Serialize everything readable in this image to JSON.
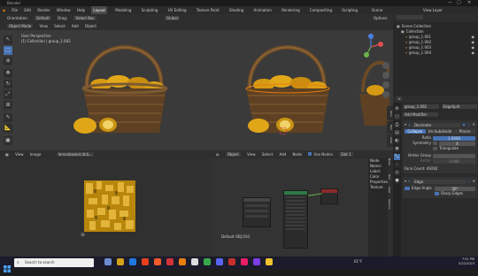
{
  "window": {
    "title": "Blender",
    "controls": [
      "—",
      "▢",
      "✕"
    ]
  },
  "menubar": {
    "logo": "◆",
    "menus": [
      "File",
      "Edit",
      "Render",
      "Window",
      "Help"
    ],
    "workspaces": [
      "Layout",
      "Modeling",
      "Sculpting",
      "UV Editing",
      "Texture Paint",
      "Shading",
      "Animation",
      "Rendering",
      "Compositing",
      "Scripting"
    ],
    "active_workspace": "Layout",
    "scene": "Scene",
    "view_layer": "View Layer"
  },
  "viewport_header": {
    "orientation_label": "Orientation:",
    "orientation_value": "Default",
    "drag_label": "Drag:",
    "drag_value": "Select Box",
    "mode": "Object Mode",
    "view": "View",
    "select": "Select",
    "add": "Add",
    "object": "Object",
    "transform": "Global",
    "options": "Options"
  },
  "viewport": {
    "perspective": "User Perspective",
    "collection_label": "(1) Collection | group_1.002"
  },
  "outliner": {
    "items": [
      {
        "label": "Scene Collection",
        "indent": 0
      },
      {
        "label": "Collection",
        "indent": 1
      },
      {
        "label": "group_1.001",
        "indent": 2
      },
      {
        "label": "group_1.002",
        "indent": 2
      },
      {
        "label": "group_1.003",
        "indent": 2
      },
      {
        "label": "group_1.004",
        "indent": 2
      }
    ]
  },
  "properties": {
    "object_name": "group_1.002",
    "modifier_search": "EdgeSplit",
    "add_modifier": "Add Modifier",
    "decimate": {
      "name": "Decimate",
      "tabs": [
        "Collapse",
        "Un-Subdivide",
        "Planar"
      ],
      "ratio_label": "Ratio",
      "ratio_value": "1.0000",
      "symmetry_label": "Symmetry",
      "symmetry_value": "X",
      "triangulate_label": "Triangulate",
      "vertex_group_label": "Vertex Group",
      "factor_label": "Factor",
      "factor_value": "0.000",
      "face_count": "Face Count: 49282"
    },
    "edge": {
      "name": "Edge",
      "edge_angle_label": "Edge Angle",
      "edge_angle_value": "30°",
      "sharp_edges_label": "Sharp Edges"
    }
  },
  "image_editor": {
    "menus": [
      "View",
      "Image"
    ],
    "image_name": "lemonbasket.dirb..."
  },
  "node_editor": {
    "menus": [
      "Object",
      "View",
      "Select",
      "Add",
      "Node"
    ],
    "use_nodes": "Use Nodes",
    "slot": "Slot 1",
    "material": "Default OBJ.010",
    "material_label": "Default OBJ.010",
    "sidebar_items": [
      "Node",
      "Name:",
      "Label:",
      "Color",
      "Properties",
      "Texture"
    ],
    "sidebar_tabs": [
      "Node",
      "Tool",
      "View",
      "Options"
    ]
  },
  "n_panel_tabs": [
    "Item",
    "Tool",
    "View"
  ],
  "taskbar": {
    "search_placeholder": "Search to search",
    "weather": "61°F",
    "time": "7:51 PM",
    "date": "5/22/2023"
  },
  "colors": {
    "accent": "#4772b3",
    "header": "#2e2e2e",
    "panel": "#282828",
    "viewport": "#3a3a3a"
  }
}
